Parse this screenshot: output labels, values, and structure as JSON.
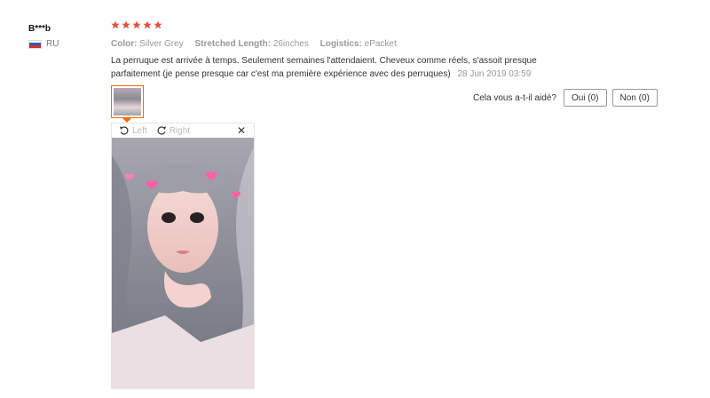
{
  "reviewer": {
    "name": "B***b",
    "country_code": "RU"
  },
  "rating": {
    "stars": 5,
    "max": 5,
    "color": "#e8503a"
  },
  "attributes": [
    {
      "label": "Color:",
      "value": "Silver Grey"
    },
    {
      "label": "Stretched Length:",
      "value": "26inches"
    },
    {
      "label": "Logistics:",
      "value": "ePacket"
    }
  ],
  "review": {
    "text": "La perruque est arrivée à temps. Seulement semaines l'attendaient. Cheveux comme réels, s'assoit presque parfaitement (je pense presque car c'est ma première expérience avec des perruques)",
    "date": "28 Jun 2019 03:59"
  },
  "helpful": {
    "question": "Cela vous a-t-il aidé?",
    "yes_label": "Oui (0)",
    "no_label": "Non (0)"
  },
  "viewer": {
    "rotate_left_label": "Left",
    "rotate_right_label": "Right",
    "close_icon": "close-icon"
  },
  "colors": {
    "accent_orange": "#ff6a00",
    "star_red": "#e8503a"
  }
}
